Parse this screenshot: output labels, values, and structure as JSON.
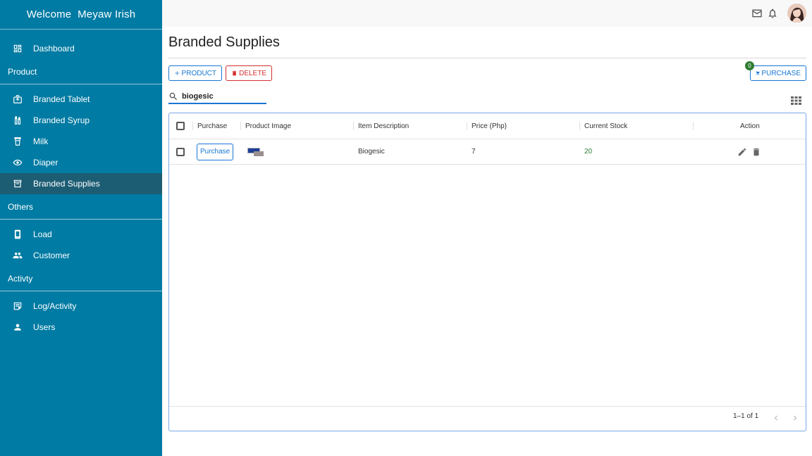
{
  "sidebar": {
    "welcome": "Welcome  Meyaw Irish",
    "dashboard": "Dashboard",
    "sections": {
      "product": "Product",
      "others": "Others",
      "activity": "Activty"
    },
    "product_items": [
      "Branded Tablet",
      "Branded Syrup",
      "Milk",
      "Diaper",
      "Branded Supplies"
    ],
    "others_items": [
      "Load",
      "Customer"
    ],
    "activity_items": [
      "Log/Activity",
      "Users"
    ],
    "active_item": "Branded Supplies"
  },
  "header": {
    "icons": [
      "mail-icon",
      "bell-icon",
      "avatar"
    ]
  },
  "main": {
    "title": "Branded Supplies",
    "add_product_label": "PRODUCT",
    "delete_label": "DELETE",
    "purchase_label": "PURCHASE",
    "cart_badge": "0",
    "search_value": "biogesic"
  },
  "table": {
    "columns": [
      "Purchase",
      "Product Image",
      "Item Description",
      "Price (Php)",
      "Current Stock",
      "Action"
    ],
    "rows": [
      {
        "purchase_button": "Purchase",
        "item_description": "Biogesic",
        "price": "7",
        "current_stock": "20"
      }
    ],
    "pagination": "1–1 of 1"
  },
  "colors": {
    "sidebar": "#007ba3",
    "sidebar_active": "#1d5d74",
    "primary": "#1976d2",
    "danger": "#d32f2f",
    "stock": "#2e7d32"
  }
}
